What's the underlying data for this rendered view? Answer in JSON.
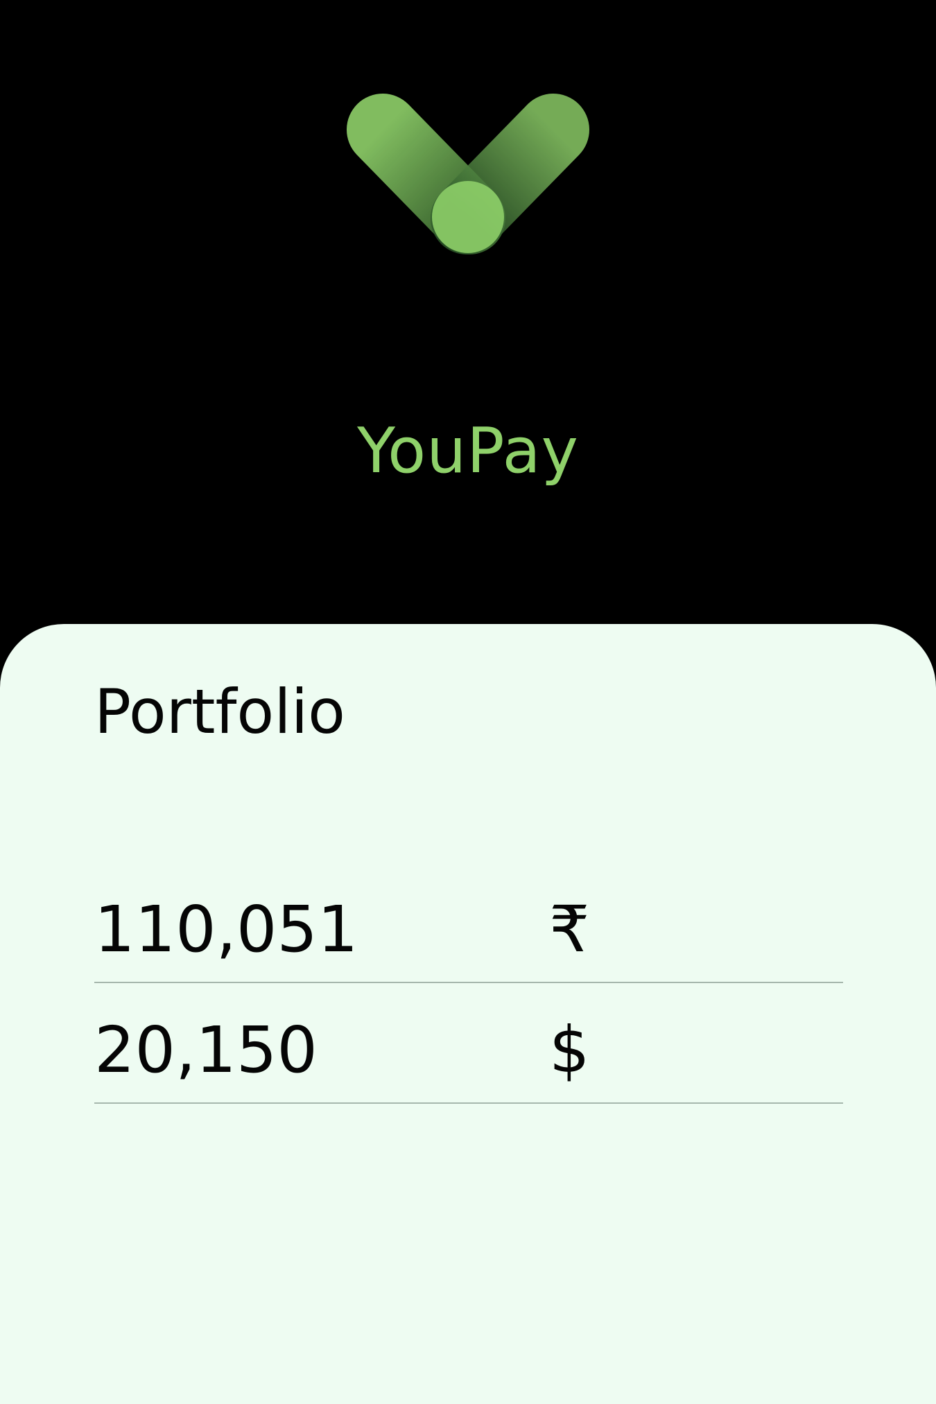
{
  "app": {
    "name": "YouPay",
    "logo_icon": "youpay-y-logo-icon"
  },
  "colors": {
    "background": "#000000",
    "brand_green": "#8fd16a",
    "card_background": "#eefcf2",
    "text": "#050505",
    "divider": "#a6b7ad"
  },
  "portfolio": {
    "title": "Portfolio",
    "rows": [
      {
        "amount": "110,051",
        "currency": "₹"
      },
      {
        "amount": "20,150",
        "currency": "$"
      }
    ]
  }
}
